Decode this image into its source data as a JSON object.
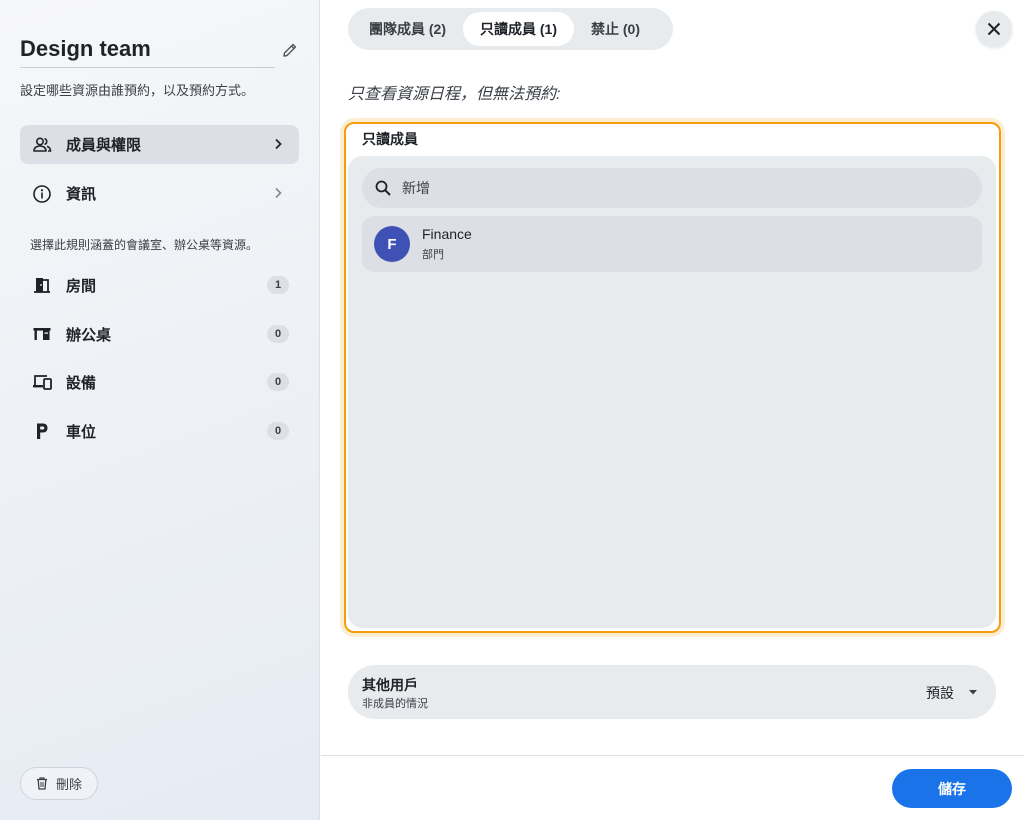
{
  "sidebar": {
    "title": "Design team",
    "subtitle": "設定哪些資源由誰預約，以及預約方式。",
    "nav": [
      {
        "label": "成員與權限",
        "icon": "people-icon"
      },
      {
        "label": "資訊",
        "icon": "info-icon"
      }
    ],
    "resources_note": "選擇此規則涵蓋的會議室、辦公桌等資源。",
    "resources": [
      {
        "label": "房間",
        "count": "1",
        "icon": "door-icon"
      },
      {
        "label": "辦公桌",
        "count": "0",
        "icon": "desk-icon"
      },
      {
        "label": "設備",
        "count": "0",
        "icon": "devices-icon"
      },
      {
        "label": "車位",
        "count": "0",
        "icon": "parking-icon"
      }
    ],
    "delete_label": "刪除"
  },
  "main": {
    "tabs": [
      {
        "label": "團隊成員 (2)",
        "active": false
      },
      {
        "label": "只讀成員 (1)",
        "active": true
      },
      {
        "label": "禁止 (0)",
        "active": false
      }
    ],
    "description": "只查看資源日程，但無法預約:",
    "members_title": "只讀成員",
    "search_placeholder": "新增",
    "members": [
      {
        "initial": "F",
        "name": "Finance",
        "type": "部門",
        "avatar_color": "#3f51b5"
      }
    ],
    "others": {
      "title": "其他用戶",
      "subtitle": "非成員的情況",
      "value": "預設"
    },
    "save_label": "儲存"
  },
  "colors": {
    "accent": "#1a73e8",
    "highlight": "#f59e0b",
    "avatar": "#3f51b5"
  }
}
